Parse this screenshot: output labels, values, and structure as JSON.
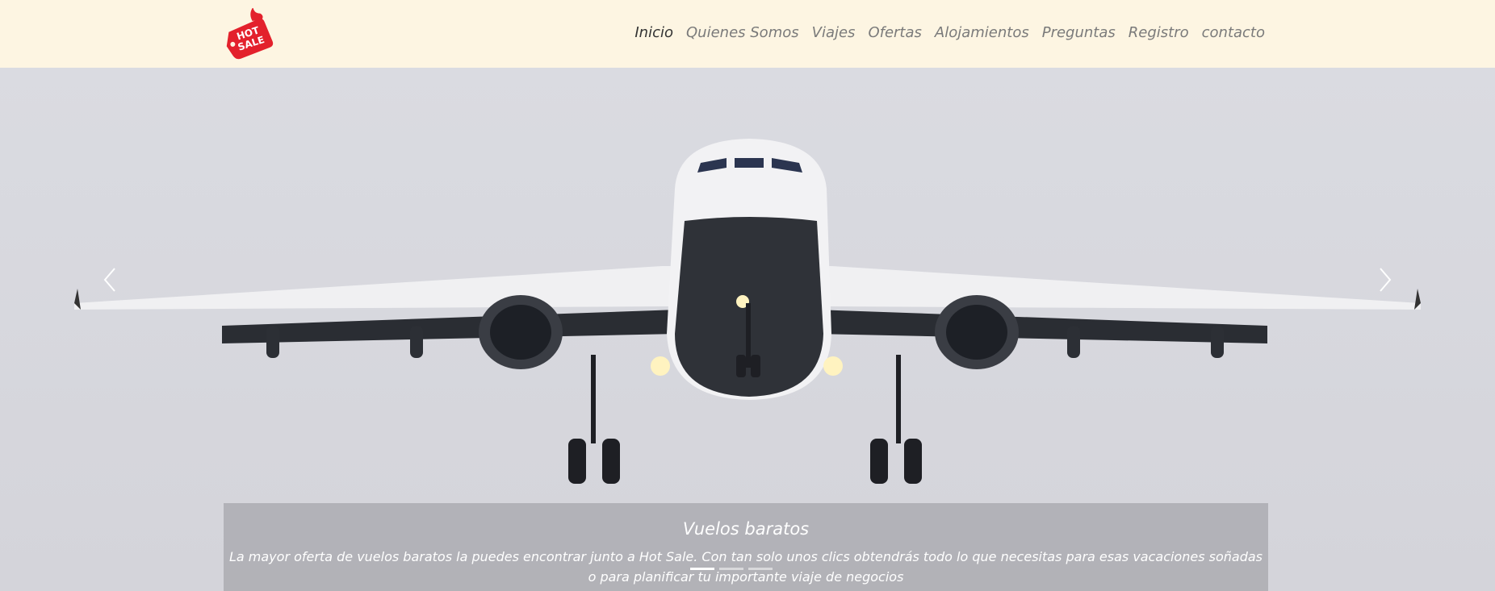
{
  "header": {
    "logo": {
      "line1": "HOT",
      "line2": "SALE",
      "color": "#e3212c"
    },
    "nav": [
      {
        "label": "Inicio",
        "active": true
      },
      {
        "label": "Quienes Somos"
      },
      {
        "label": "Viajes"
      },
      {
        "label": "Ofertas"
      },
      {
        "label": "Alojamientos"
      },
      {
        "label": "Preguntas"
      },
      {
        "label": "Registro"
      },
      {
        "label": "contacto"
      }
    ]
  },
  "carousel": {
    "prev_icon": "chevron-left-icon",
    "next_icon": "chevron-right-icon",
    "slide_count": 3,
    "active_index": 0,
    "caption": {
      "title": "Vuelos baratos",
      "text": "La mayor oferta de vuelos baratos la puedes encontrar junto a Hot Sale. Con tan solo unos clics obtendrás todo lo que necesitas para esas vacaciones soñadas o para planificar tu importante viaje de negocios"
    }
  }
}
